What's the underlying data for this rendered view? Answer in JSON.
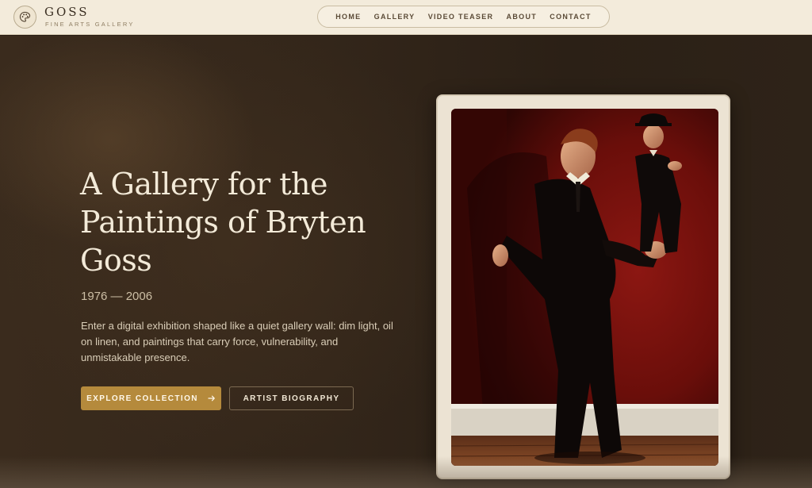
{
  "brand": {
    "name": "GOSS",
    "tagline": "FINE ARTS GALLERY",
    "logo_icon": "palette-icon"
  },
  "nav": {
    "items": [
      {
        "label": "HOME"
      },
      {
        "label": "GALLERY"
      },
      {
        "label": "VIDEO TEASER"
      },
      {
        "label": "ABOUT"
      },
      {
        "label": "CONTACT"
      }
    ]
  },
  "hero": {
    "title": "A Gallery for the Paintings of Bryten Goss",
    "years": "1976 — 2006",
    "description": "Enter a digital exhibition shaped like a quiet gallery wall: dim light, oil on linen, and paintings that carry force, vulnerability, and unmistakable presence.",
    "primary_button": "EXPLORE COLLECTION",
    "primary_button_icon": "arrow-right-icon",
    "secondary_button": "ARTIST BIOGRAPHY"
  },
  "colors": {
    "header_bg": "#f3ebdb",
    "hero_bg": "#33261a",
    "accent": "#b58a3c",
    "painting_red": "#6e0f0b"
  }
}
